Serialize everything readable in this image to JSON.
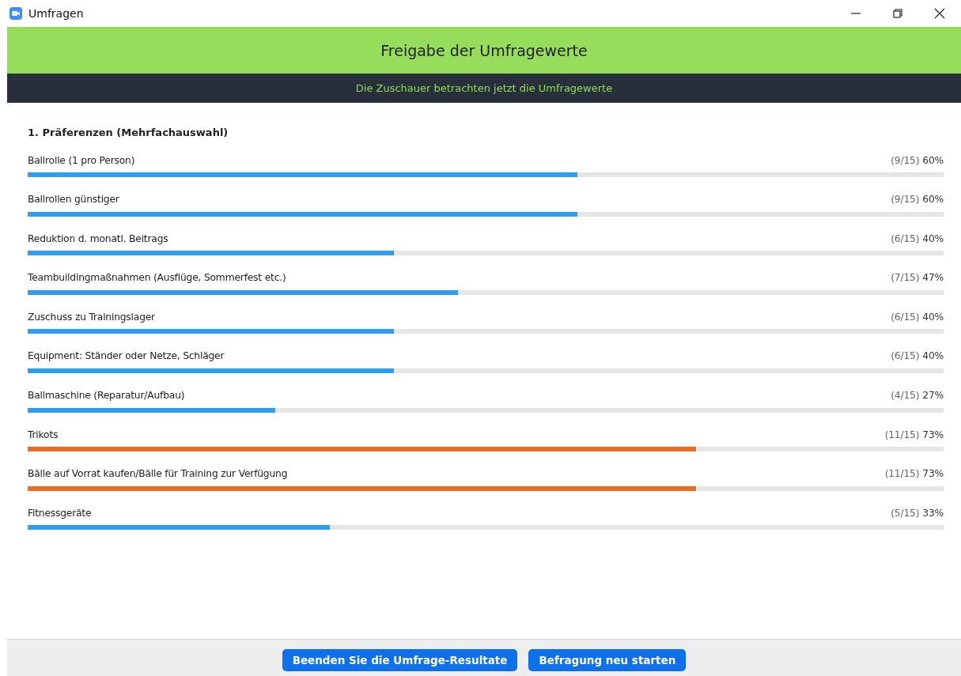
{
  "window": {
    "title": "Umfragen"
  },
  "header": {
    "title": "Freigabe der Umfragewerte",
    "status": "Die Zuschauer betrachten jetzt die Umfragewerte"
  },
  "question": {
    "title": "1. Präferenzen (Mehrfachauswahl)",
    "answers": [
      {
        "label": "Ballrolle (1 pro Person)",
        "count": "(9/15)",
        "percent": "60%",
        "level": 0.6,
        "color": "#2e9ef5"
      },
      {
        "label": "Ballrollen günstiger",
        "count": "(9/15)",
        "percent": "60%",
        "level": 0.6,
        "color": "#2e9ef5"
      },
      {
        "label": "Reduktion d. monatl. Beitrags",
        "count": "(6/15)",
        "percent": "40%",
        "level": 0.4,
        "color": "#2e9ef5"
      },
      {
        "label": "Teambuildingmaßnahmen (Ausflüge, Sommerfest etc.)",
        "count": "(7/15)",
        "percent": "47%",
        "level": 0.47,
        "color": "#2e9ef5"
      },
      {
        "label": "Zuschuss zu Trainingslager",
        "count": "(6/15)",
        "percent": "40%",
        "level": 0.4,
        "color": "#2e9ef5"
      },
      {
        "label": "Equipment: Ständer oder Netze, Schläger",
        "count": "(6/15)",
        "percent": "40%",
        "level": 0.4,
        "color": "#2e9ef5"
      },
      {
        "label": "Ballmaschine (Reparatur/Aufbau)",
        "count": "(4/15)",
        "percent": "27%",
        "level": 0.27,
        "color": "#2e9ef5"
      },
      {
        "label": "Trikots",
        "count": "(11/15)",
        "percent": "73%",
        "level": 0.73,
        "color": "#ef6a22"
      },
      {
        "label": "Bälle auf Vorrat kaufen/Bälle für Training zur Verfügung",
        "count": "(11/15)",
        "percent": "73%",
        "level": 0.73,
        "color": "#ef6a22"
      },
      {
        "label": "Fitnessgeräte",
        "count": "(5/15)",
        "percent": "33%",
        "level": 0.33,
        "color": "#2e9ef5"
      }
    ]
  },
  "buttons": [
    "Beenden Sie die Umfrage-Resultate",
    "Befragung neu starten"
  ]
}
